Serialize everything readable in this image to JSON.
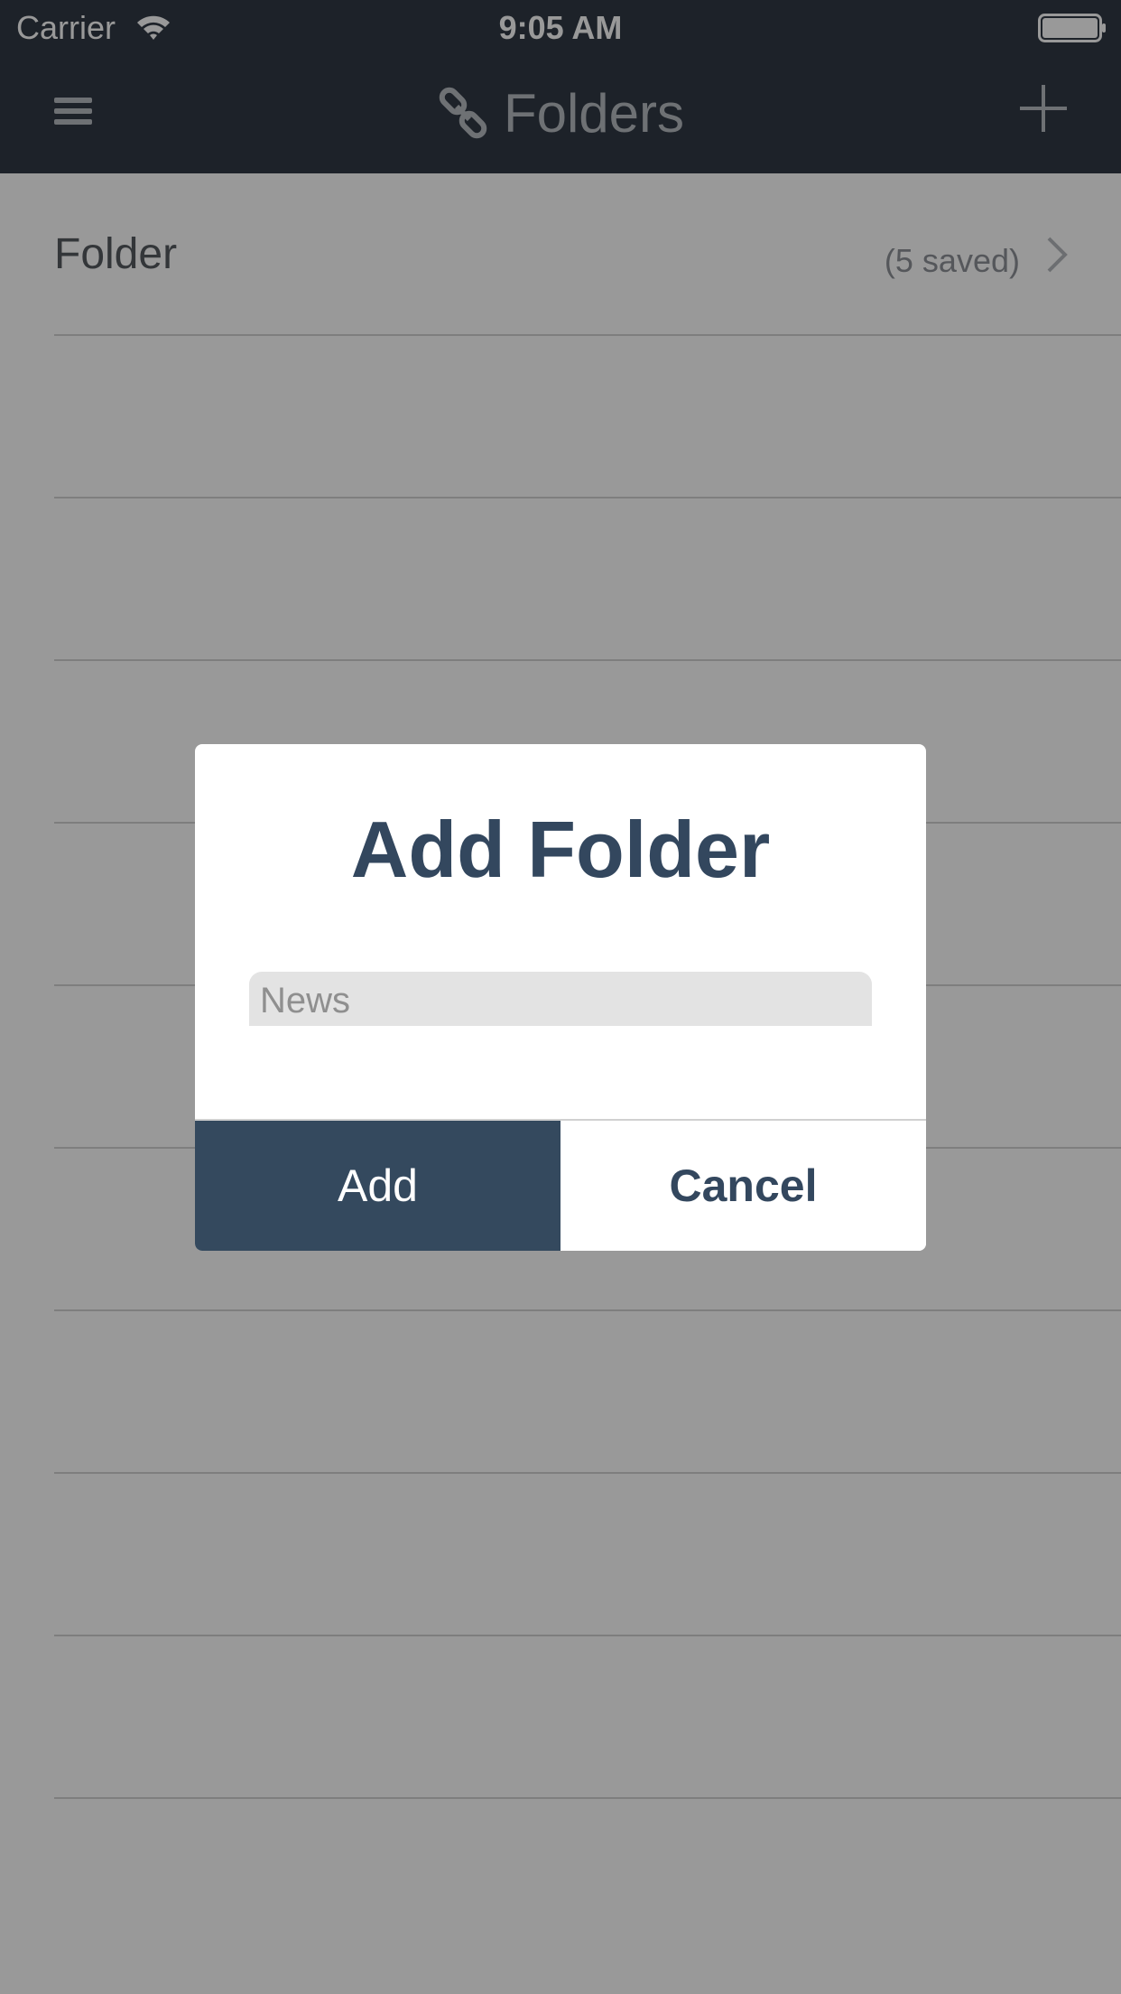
{
  "status_bar": {
    "carrier": "Carrier",
    "time": "9:05 AM",
    "wifi_icon": "wifi-icon",
    "battery_icon": "battery-icon"
  },
  "nav_bar": {
    "title": "Folders",
    "title_icon": "link-icon",
    "left_icon": "menu-icon",
    "right_icon": "plus-icon",
    "background": "#313a45"
  },
  "folders": [
    {
      "name": "Folder",
      "count": "(5 saved)"
    }
  ],
  "dialog": {
    "title": "Add Folder",
    "input_placeholder": "News",
    "input_value": "",
    "add_label": "Add",
    "cancel_label": "Cancel",
    "accent": "#34495e"
  }
}
